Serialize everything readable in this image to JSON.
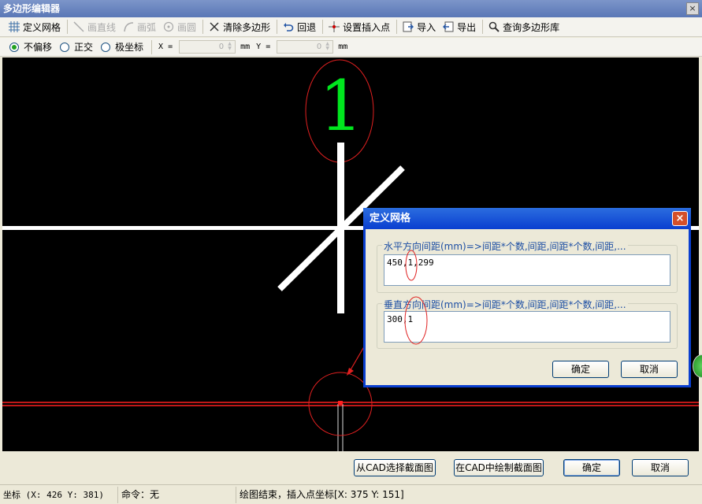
{
  "window": {
    "title": "多边形编辑器",
    "close_glyph": "×"
  },
  "toolbar": {
    "items": [
      {
        "label": "定义网格",
        "icon": "grid-icon",
        "enabled": true
      },
      {
        "label": "画直线",
        "icon": "line-icon",
        "enabled": false
      },
      {
        "label": "画弧",
        "icon": "arc-icon",
        "enabled": false
      },
      {
        "label": "画圆",
        "icon": "circle-icon",
        "enabled": false
      },
      {
        "label": "清除多边形",
        "icon": "clear-icon",
        "enabled": true
      },
      {
        "label": "回退",
        "icon": "undo-icon",
        "enabled": true
      },
      {
        "label": "设置插入点",
        "icon": "insert-point-icon",
        "enabled": true
      },
      {
        "label": "导入",
        "icon": "import-icon",
        "enabled": true
      },
      {
        "label": "导出",
        "icon": "export-icon",
        "enabled": true
      },
      {
        "label": "查询多边形库",
        "icon": "search-icon",
        "enabled": true
      }
    ]
  },
  "options": {
    "modes": [
      {
        "label": "不偏移",
        "selected": true
      },
      {
        "label": "正交",
        "selected": false
      },
      {
        "label": "极坐标",
        "selected": false
      }
    ],
    "x_label": "X =",
    "x_value": "0",
    "x_unit": "mm",
    "y_label": "Y =",
    "y_value": "0",
    "y_unit": "mm"
  },
  "canvas": {
    "axis_number": "1",
    "colors": {
      "background": "#000000",
      "axis_label": "#00ff00",
      "grid_line": "#ffffff",
      "red_line": "#ff2020",
      "annotation": "#e02020"
    }
  },
  "dialog": {
    "title": "定义网格",
    "horizontal_label": "水平方向间距(mm)=>间距*个数,间距,间距*个数,间距,...",
    "horizontal_value": "450,1,299",
    "vertical_label": "垂直方向间距(mm)=>间距*个数,间距,间距*个数,间距,...",
    "vertical_value": "300,1",
    "ok_label": "确定",
    "cancel_label": "取消"
  },
  "bottom_buttons": {
    "select_from_cad": "从CAD选择截面图",
    "draw_in_cad": "在CAD中绘制截面图",
    "ok": "确定",
    "cancel": "取消"
  },
  "status": {
    "coords": "坐标 (X: 426 Y: 381)",
    "command": "命令：无",
    "message": "绘图结束，插入点坐标[X: 375 Y: 151]"
  }
}
